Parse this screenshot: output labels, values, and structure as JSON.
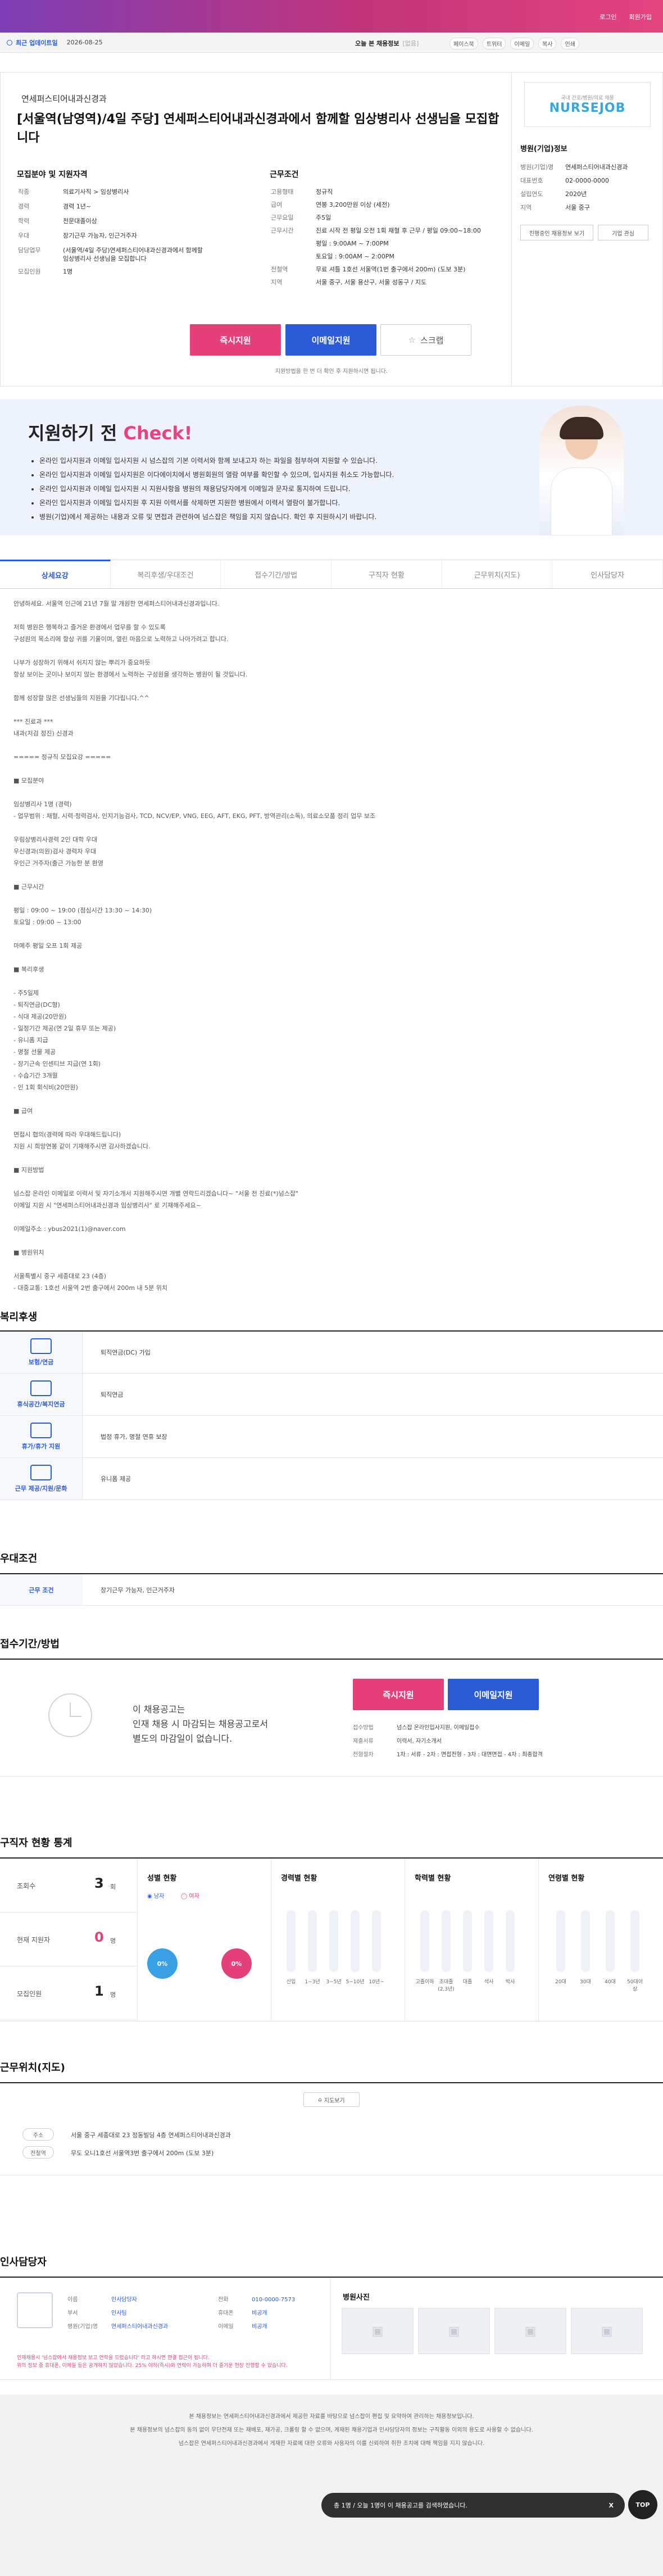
{
  "topbar": {
    "links": [
      "로그인",
      "회원가입"
    ]
  },
  "subbar": {
    "recent": "최근 업데이트일",
    "date": "2026-08-25",
    "today": "오늘 본 채용정보",
    "today_count": "[없음]",
    "share": [
      "페이스북",
      "트위터",
      "이메일",
      "복사",
      "인쇄"
    ]
  },
  "job": {
    "company": "연세퍼스티어내과신경과",
    "title": "[서울역(남영역)/4일 주당] 연세퍼스티어내과신경과에서 함께할 임상병리사 선생님을 모집합니다",
    "qualifications_heading": "모집분야 및 지원자격",
    "conditions_heading": "근무조건",
    "qualifications": [
      {
        "k": "직종",
        "v": "의료기사직 > 임상병리사"
      },
      {
        "k": "경력",
        "v": "경력 1년~"
      },
      {
        "k": "학력",
        "v": "전문대졸이상"
      },
      {
        "k": "우대",
        "v": "장기근무 가능자, 인근거주자"
      },
      {
        "k": "담당업무",
        "v": "(서울역/4일 주당)연세퍼스티어내과신경과에서 함께할 임상병리사 선생님을 모집합니다"
      },
      {
        "k": "모집인원",
        "v": "1명"
      }
    ],
    "conditions": [
      {
        "k": "고용형태",
        "v": "정규직"
      },
      {
        "k": "급여",
        "v": "연봉 3,200만원 이상 (세전)"
      },
      {
        "k": "근무요일",
        "v": "주5일"
      },
      {
        "k": "근무시간",
        "v": "진료 시작 전 평일 오전 1회 채혈 후 근무 / 평일 09:00~18:00"
      },
      {
        "k": "",
        "v": "평일 : 9:00AM ~ 7:00PM"
      },
      {
        "k": "",
        "v": "토요일 : 9:00AM ~ 2:00PM"
      },
      {
        "k": "전철역",
        "v": "무료 셔틀 1호선 서울역(1번 출구에서 200m) (도보 3분)"
      },
      {
        "k": "지역",
        "v": "서울 중구, 서울 용산구, 서울 성동구 / 지도"
      }
    ]
  },
  "hospital": {
    "heading": "병원(기업)정보",
    "logo_top": "국내 간호/병원/의료 채용",
    "logo_main": "NURSEJOB",
    "info": [
      {
        "k": "병원(기업)명",
        "v": "연세퍼스티어내과신경과"
      },
      {
        "k": "대표번호",
        "v": "02-0000-0000"
      },
      {
        "k": "설립연도",
        "v": "2020년"
      },
      {
        "k": "지역",
        "v": "서울 중구"
      }
    ],
    "btn_more": "진행중인 채용정보 보기",
    "btn_fav": "기업 관심"
  },
  "actions": {
    "apply_now": "즉시지원",
    "email_apply": "이메일지원",
    "scrap": "스크랩",
    "note": "지원방법을 한 번 더 확인 후 지원하시면 됩니다."
  },
  "check": {
    "title_a": "지원하기 전 ",
    "title_b": "Check!",
    "items": [
      "온라인 입사지원과 이메일 입사지원 시 넘스잡의 기본 이력서와 함께 보내고자 하는 파일을 첨부하여 지원할 수 있습니다.",
      "온라인 입사지원과 이메일 입사지원은 이다에이치에서 병원회원의 열람 여부를 확인할 수 있으며, 입사지원 취소도 가능합니다.",
      "온라인 입사지원과 이메일 입사지원 시 지원사항을 병원의 채용담당자에게 이메일과 문자로 통지하여 드립니다.",
      "온라인 입사지원과 이메일 입사지원 후 지원 이력서를 삭제하면 지원한 병원에서 이력서 열람이 불가합니다.",
      "병원(기업)에서 제공하는 내용과 오류 및 면접과 관련하여 넘스잡은 책임을 지지 않습니다. 확인 후 지원하시기 바랍니다."
    ]
  },
  "tabs": [
    "상세요강",
    "복리후생/우대조건",
    "접수기간/방법",
    "구직자 현황",
    "근무위치(지도)",
    "인사담당자"
  ],
  "detail": "안녕하세요. 서울역 인근에 21년 7월 말 개원한 연세퍼스티어내과신경과입니다.\n\n저희 병원은 행복하고 즐거운 환경에서 업무를 할 수 있도록\n구성원의 목소리에 항상 귀를 기울이며, 열린 마음으로 노력하고 나아가려고 합니다.\n\n나부가 성장하기 위해서 쉬지지 않는 뿌리가 중요하듯\n항상 보이는 곳이나 보이지 않는 환경에서 노력하는 구성원을 생각하는 병원이 될 것입니다.\n\n함께 성장할 많은 선생님들의 지원을 기다립니다.^^\n\n*** 진료과 ***\n내과(저검 정진) 신경과\n\n===== 정규직 모집요강 =====\n\n■ 모집분야\n\n임상병리사 1명 (경력)\n- 업무범위 : 채혈, 시력·청력검사, 인지기능검사, TCD, NCV/EP, VNG, EEG, AFT, EKG, PFT, 방역관리(소독), 의료소모품 정리 업무 보조\n\n우림상병리사경력 2인 대학 우대\n우신경과(의원)검사 경력자 우대\n우인근 거주자(출근 가능한 분 환영\n\n■ 근무시간\n\n평일 : 09:00 ~ 19:00 (점심시간 13:30 ~ 14:30)\n토요일 : 09:00 ~ 13:00\n\n마메주 평일 오프 1회 제공\n\n■ 복리후생\n\n- 주5일제\n- 퇴직연금(DC형)\n- 식대 제공(20만원)\n- 일정기간 제공(연 2일 휴무 또는 제공)\n- 유니폼 지급\n- 명절 선물 제공\n- 장기근속 인센티브 지급(연 1회)\n- 수습기간 3개월\n- 인 1회 회식비(20만원)\n\n■ 급여\n\n면접시 협의(경력에 따라 우대해드립니다)\n지원 시 희망연봉 같이 기재해주시면 감사하겠습니다.\n\n■ 지원방법\n\n넘스잡 온라인 이메일로 이력서 및 자기소개서 지원해주시면 개별 연락드리겠습니다~ \"서울 전 진료(*)넘스잡\"\n이메일 지원 시 \"연세퍼스티어내과신경과 임상병리사\" 로 기재해주세요~\n\n이메일주소 : ybus2021(1)@naver.com\n\n■ 병원위치\n\n서울특별시 중구 세종대로 23 (4층)\n- 대중교통: 1호선 서울역 2번 출구에서 200m 내 5분 위치",
  "welfare": {
    "heading": "복리후생",
    "rows": [
      {
        "icon": "보험/연금",
        "v": "퇴직연금(DC) 가입"
      },
      {
        "icon": "휴식공간/복지연금",
        "v": "퇴직연금"
      },
      {
        "icon": "휴가/휴가 지원",
        "v": "법정 휴가, 명절 연휴 보장"
      },
      {
        "icon": "근무 제공/지원/문화",
        "v": "유니폼 제공"
      }
    ]
  },
  "preferred": {
    "heading": "우대조건",
    "k": "근무 조건",
    "v": "장기근무 가능자, 인근거주자"
  },
  "apply_section": {
    "heading": "접수기간/방법",
    "closed_msg": "이 채용공고는\n인재 채용 시 마감되는 채용공고로서\n별도의 마감일이 없습니다.",
    "btn_apply": "즉시지원",
    "btn_email": "이메일지원",
    "info": [
      {
        "k": "접수방법",
        "v": "넘스잡 온라인입사지원, 이메일접수"
      },
      {
        "k": "제출서류",
        "v": "이력서, 자기소개서"
      },
      {
        "k": "전형절차",
        "v": "1차 : 서류 - 2차 : 면접전형 - 3차 : 대면면접 - 4차 : 최종합격"
      }
    ]
  },
  "stats": {
    "heading": "구직자 현황 통계",
    "summary": [
      {
        "k": "조회수",
        "v": "3",
        "u": "회"
      },
      {
        "k": "현재 지원자",
        "v": "0",
        "u": "명"
      },
      {
        "k": "모집인원",
        "v": "1",
        "u": "명"
      }
    ],
    "gender": {
      "title": "성별 현황",
      "male": "남자",
      "female": "여자",
      "male_pct": "0%",
      "female_pct": "0%"
    },
    "career": {
      "title": "경력별 현황",
      "labels": [
        "신입",
        "1~3년",
        "3~5년",
        "5~10년",
        "10년~"
      ],
      "values": [
        0,
        0,
        0,
        0,
        0
      ]
    },
    "education": {
      "title": "학력별 현황",
      "labels": [
        "고졸이하",
        "초대졸(2,3년)",
        "대졸",
        "석사",
        "박사"
      ],
      "values": [
        0,
        0,
        0,
        0,
        0
      ]
    },
    "age": {
      "title": "연령별 현황",
      "labels": [
        "20대",
        "30대",
        "40대",
        "50대이상"
      ],
      "values": [
        0,
        0,
        0,
        0
      ]
    }
  },
  "location": {
    "heading": "근무위치(지도)",
    "map_btn": "지도보기",
    "addr_k": "주소",
    "addr_v": "서울 중구 세종대로 23 정동빌딩 4층 연세퍼스티어내과신경과",
    "subway_k": "전철역",
    "subway_v": "무도 오니1호선 서울역3번 출구에서 200m (도보 3분)"
  },
  "manager": {
    "heading": "인사담당자",
    "info": [
      {
        "k": "이름",
        "v": "인사담당자",
        "k2": "전화",
        "v2": "010-0000-7573"
      },
      {
        "k": "부서",
        "v": "인사팀",
        "k2": "휴대폰",
        "v2": "비공개"
      },
      {
        "k": "병원(기업)명",
        "v": "연세퍼스티어내과신경과",
        "k2": "이메일",
        "v2": "비공개"
      }
    ],
    "notice": "인재채용시 '넘스잡에서 채용정보 보고 연락을 드렸습니다' 라고 하시면 한결 접근이 됩니다.\n위의 정보 중 휴대폰, 이메일 등은 공개하지 않았습니다. 25% 이하(즉시)와 연락이 가능하며 더 즐거운 현장 진행할 수 있습니다.",
    "photos_heading": "병원사진"
  },
  "footer": {
    "line1": "본 채용정보는 연세퍼스티어내과신경과에서 제공한 자료를 바탕으로 넘스잡이 편집 및 요약하여 관리하는 채용정보입니다.",
    "line2": "본 채용정보의 넘스잡의 동의 없이 무단전재 또는 재배포, 재가공, 크롤링 할 수 없으며, 게재된 채용기업과 인사담당자의 정보는 구직활동 이외의 용도로 사용할 수 없습니다.",
    "line3": "넘스잡은 연세퍼스티어내과신경과에서 게재한 자료에 대한 오류와 사용자의 이를 신뢰하여 취한 조치에 대해 책임을 지지 않습니다.",
    "toast": "총 1명 / 오늘 1명이 이 채용공고를 검색하였습니다.",
    "close": "X",
    "top": "TOP"
  }
}
